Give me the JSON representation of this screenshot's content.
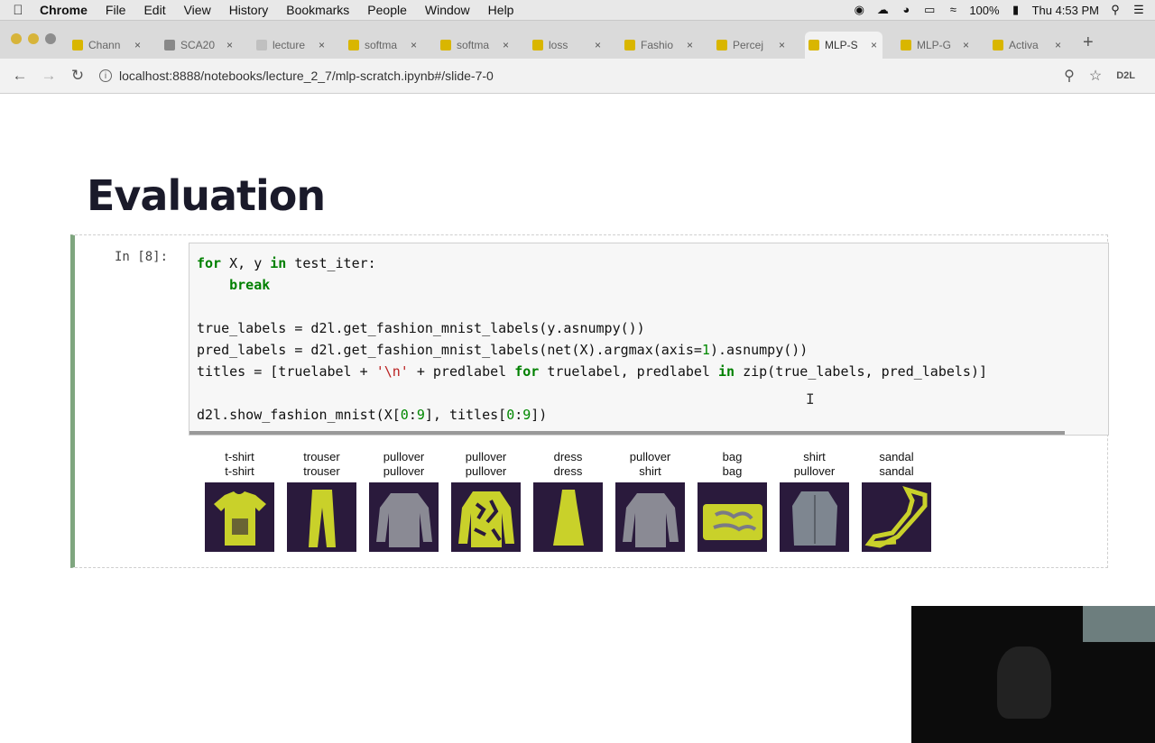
{
  "menubar": {
    "app": "Chrome",
    "items": [
      "File",
      "Edit",
      "View",
      "History",
      "Bookmarks",
      "People",
      "Window",
      "Help"
    ],
    "battery": "100%",
    "clock": "Thu 4:53 PM"
  },
  "tabs": [
    {
      "label": "Chann",
      "color": "#d9b600"
    },
    {
      "label": "SCA20",
      "color": "#888888"
    },
    {
      "label": "lecture",
      "color": "#c0c0c0"
    },
    {
      "label": "softma",
      "color": "#d9b600"
    },
    {
      "label": "softma",
      "color": "#d9b600"
    },
    {
      "label": "loss",
      "color": "#d9b600"
    },
    {
      "label": "Fashio",
      "color": "#d9b600"
    },
    {
      "label": "Percej",
      "color": "#d9b600"
    },
    {
      "label": "MLP-S",
      "color": "#d9b600"
    },
    {
      "label": "MLP-G",
      "color": "#d9b600"
    },
    {
      "label": "Activa",
      "color": "#d9b600"
    }
  ],
  "active_tab_index": 8,
  "address": {
    "url": "localhost:8888/notebooks/lecture_2_7/mlp-scratch.ipynb#/slide-7-0",
    "ext_label": "D2L"
  },
  "slide": {
    "title": "Evaluation",
    "prompt": "In [8]:"
  },
  "images": [
    {
      "true": "t-shirt",
      "pred": "t-shirt",
      "shape": "shirt"
    },
    {
      "true": "trouser",
      "pred": "trouser",
      "shape": "trouser"
    },
    {
      "true": "pullover",
      "pred": "pullover",
      "shape": "pullover"
    },
    {
      "true": "pullover",
      "pred": "pullover",
      "shape": "pullover-pattern"
    },
    {
      "true": "dress",
      "pred": "dress",
      "shape": "dress"
    },
    {
      "true": "pullover",
      "pred": "shirt",
      "shape": "pullover"
    },
    {
      "true": "bag",
      "pred": "bag",
      "shape": "bag"
    },
    {
      "true": "shirt",
      "pred": "pullover",
      "shape": "shirt-dark"
    },
    {
      "true": "sandal",
      "pred": "sandal",
      "shape": "sandal"
    }
  ],
  "colors": {
    "thumb_bg": "#2a1a3c",
    "thumb_fg": "#c9d12a",
    "cell_border": "#7fa67f"
  }
}
